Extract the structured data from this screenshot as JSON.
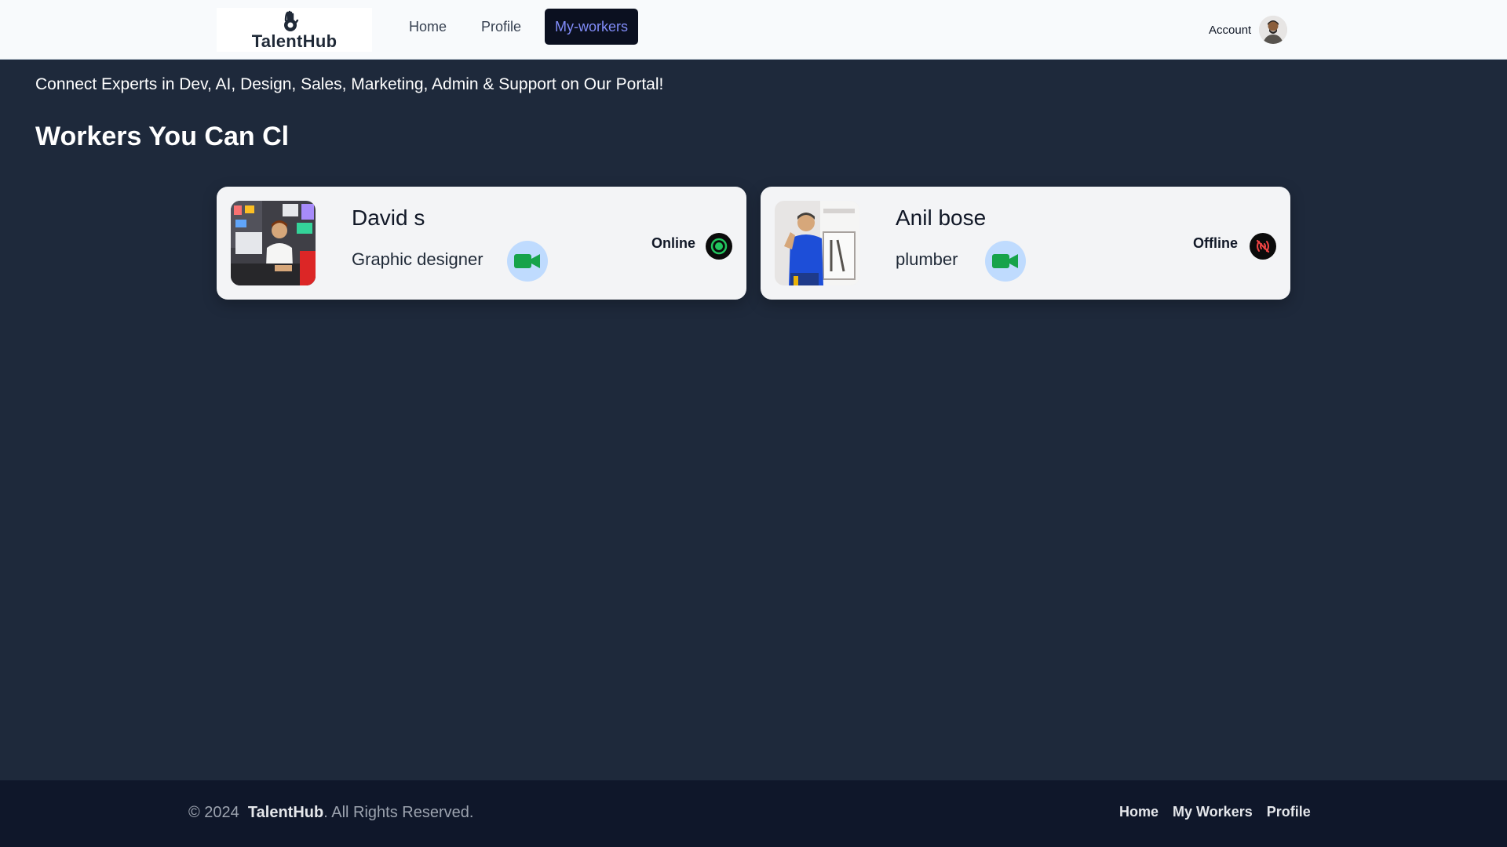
{
  "header": {
    "logo_text": "TalentHub",
    "nav": [
      {
        "label": "Home",
        "active": false
      },
      {
        "label": "Profile",
        "active": false
      },
      {
        "label": "My-workers",
        "active": true
      }
    ],
    "account_label": "Account"
  },
  "main": {
    "tagline": "Connect Experts in Dev, AI, Design, Sales, Marketing, Admin & Support on Our Portal!",
    "section_title": "Workers You Can Cl",
    "workers": [
      {
        "name": "David s",
        "role": "Graphic designer",
        "status": "Online",
        "status_color": "#22c55e",
        "video_icon": "video-camera-icon"
      },
      {
        "name": "Anil bose",
        "role": "plumber",
        "status": "Offline",
        "status_color": "#ef4444",
        "video_icon": "video-camera-icon"
      }
    ]
  },
  "footer": {
    "copyright_prefix": "© 2024",
    "brand": "TalentHub",
    "copyright_suffix": ". All Rights Reserved.",
    "links": [
      "Home",
      "My Workers",
      "Profile"
    ]
  },
  "colors": {
    "page_bg": "#1e293b",
    "footer_bg": "#0f172a",
    "active_nav_bg": "#0b1020",
    "active_nav_text": "#818cf8",
    "video_green": "#16a34a",
    "video_bg": "#bfdbfe"
  }
}
